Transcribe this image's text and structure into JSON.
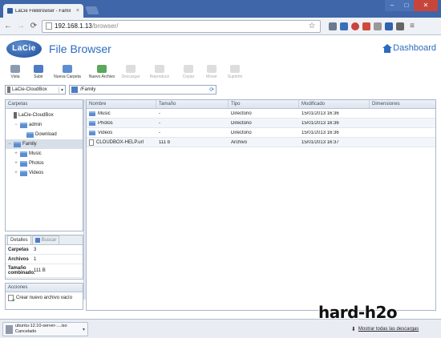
{
  "browser": {
    "tab_title": "LaCie FileBrowser - Famil",
    "tab_close": "×",
    "url_host": "192.168.1.13",
    "url_path": "/browser/",
    "nav": {
      "back": "←",
      "forward": "→",
      "reload": "⟳",
      "star": "☆",
      "menu": "≡"
    },
    "win": {
      "min": "–",
      "max": "□",
      "close": "✕"
    }
  },
  "app": {
    "logo": "LaCie",
    "title": "File Browser",
    "dashboard_label": "Dashboard"
  },
  "actions": [
    {
      "label": "Vista",
      "color": "#8a9bb2",
      "enabled": true
    },
    {
      "label": "Subir",
      "color": "#4d7cc4",
      "enabled": true
    },
    {
      "label": "Nueva Carpeta",
      "color": "#5d8ed2",
      "enabled": true
    },
    {
      "label": "Nuevo Archivo",
      "color": "#5aa85a",
      "enabled": true
    },
    {
      "label": "Descargar",
      "color": "#dddddd",
      "enabled": false
    },
    {
      "label": "Reproducir",
      "color": "#dddddd",
      "enabled": false
    },
    {
      "label": "Copiar",
      "color": "#dddddd",
      "enabled": false
    },
    {
      "label": "Mover",
      "color": "#dddddd",
      "enabled": false
    },
    {
      "label": "Suprimir",
      "color": "#dddddd",
      "enabled": false
    }
  ],
  "pathbar": {
    "device": "LaCie-CloudBox",
    "device_dropdown": "▾",
    "current_path": "/Family",
    "refresh": "⟳"
  },
  "tree": {
    "header": "Carpetas",
    "nodes": [
      {
        "label": "LaCie-CloudBox",
        "expander": "",
        "kind": "device"
      },
      {
        "label": "admin",
        "expander": "−",
        "kind": "folder"
      },
      {
        "label": "Download",
        "expander": "",
        "kind": "folder"
      },
      {
        "label": "Family",
        "expander": "−",
        "kind": "folder",
        "selected": true
      },
      {
        "label": "Music",
        "expander": "+",
        "kind": "folder"
      },
      {
        "label": "Photos",
        "expander": "+",
        "kind": "folder"
      },
      {
        "label": "Videos",
        "expander": "+",
        "kind": "folder"
      }
    ]
  },
  "grid": {
    "columns": [
      "Nombre",
      "Tamaño",
      "Tipo",
      "Modificado",
      "Dimensiones"
    ],
    "rows": [
      {
        "name": "Music",
        "size": "-",
        "type": "Directorio",
        "modified": "15/01/2013 16:36",
        "dims": "",
        "kind": "folder"
      },
      {
        "name": "Photos",
        "size": "-",
        "type": "Directorio",
        "modified": "15/01/2013 16:36",
        "dims": "",
        "kind": "folder"
      },
      {
        "name": "Videos",
        "size": "-",
        "type": "Directorio",
        "modified": "15/01/2013 16:36",
        "dims": "",
        "kind": "folder"
      },
      {
        "name": "CLOUDBOX-HELP.url",
        "size": "111 b",
        "type": "Archivo",
        "modified": "15/01/2013 16:37",
        "dims": "",
        "kind": "file"
      }
    ]
  },
  "details": {
    "tab_details": "Detalles",
    "tab_search": "Buscar",
    "rows": [
      {
        "key": "Carpetas",
        "value": "3"
      },
      {
        "key": "Archivos",
        "value": "1"
      },
      {
        "key": "Tamaño combinado:",
        "value": "111 B"
      }
    ]
  },
  "actions_panel": {
    "header": "Acciones",
    "item": "Crear nuevo archivo vacío"
  },
  "download": {
    "file": "ubuntu-12.10-server-....iso",
    "status": "Cancelado",
    "chevron": "▾",
    "show_all": "Mostrar todas las descargas",
    "show_all_icon": "⬇"
  },
  "watermark": "hard-h2o",
  "colors": {
    "accent": "#2c6cc0",
    "frame": "#3e66a8",
    "folder": "#5d8ed2"
  }
}
